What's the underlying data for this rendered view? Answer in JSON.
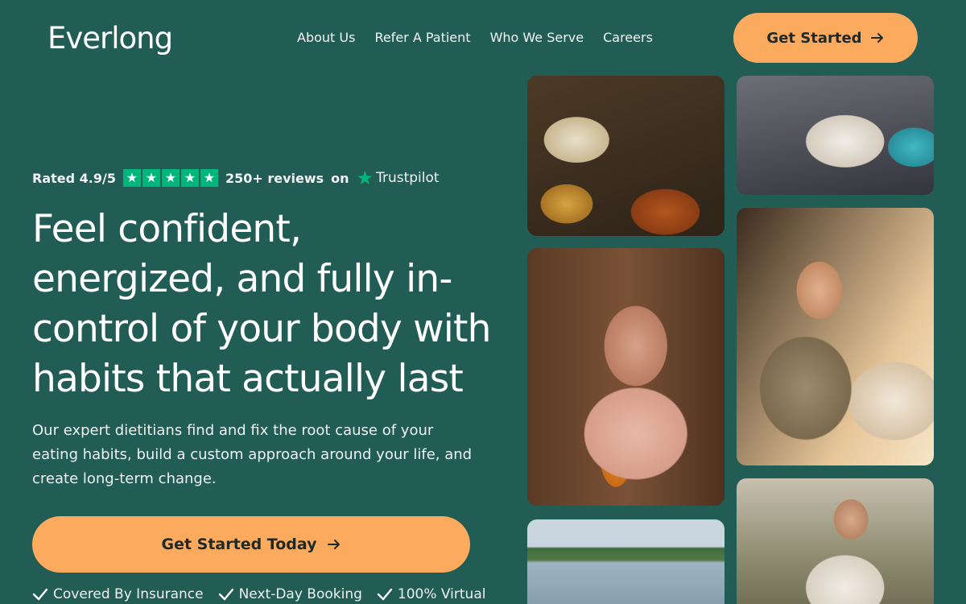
{
  "header": {
    "logo": "Everlong",
    "nav": [
      "About Us",
      "Refer A Patient",
      "Who We Serve",
      "Careers"
    ],
    "cta_label": "Get Started"
  },
  "hero": {
    "rating_text": "Rated 4.9/5",
    "star_count": 5,
    "reviews_text": "250+ reviews",
    "on_text": "on",
    "trustpilot": "Trustpilot",
    "headline": "Feel confident, energized, and fully in-control of your body with habits that actually last",
    "subcopy": "Our expert dietitians find and fix the root cause of your eating habits, build a custom approach around your life, and create long-term change.",
    "cta_label": "Get Started Today",
    "benefits": [
      "Covered By Insurance",
      "Next-Day Booking",
      "100% Virtual"
    ]
  },
  "icons": {
    "arrow": "arrow-right-icon",
    "check": "check-icon",
    "star": "star-icon"
  },
  "colors": {
    "background": "#215c55",
    "accent": "#fcaa5e",
    "trustpilot_green": "#00b67a"
  }
}
